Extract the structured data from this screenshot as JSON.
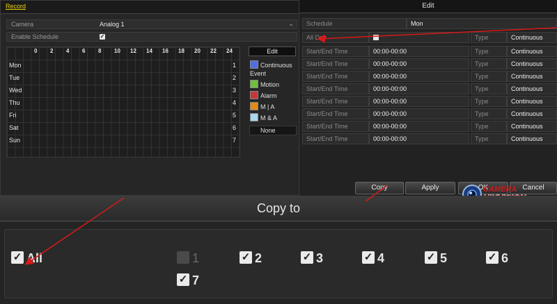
{
  "record": {
    "tab": "Record",
    "camera_label": "Camera",
    "camera_value": "Analog 1",
    "enable_label": "Enable Schedule",
    "enable_checked": true,
    "hours": [
      "0",
      "2",
      "4",
      "6",
      "8",
      "10",
      "12",
      "14",
      "16",
      "18",
      "20",
      "22",
      "24"
    ],
    "days": [
      {
        "name": "Mon",
        "num": "1"
      },
      {
        "name": "Tue",
        "num": "2"
      },
      {
        "name": "Wed",
        "num": "3"
      },
      {
        "name": "Thu",
        "num": "4"
      },
      {
        "name": "Fri",
        "num": "5"
      },
      {
        "name": "Sat",
        "num": "6"
      },
      {
        "name": "Sun",
        "num": "7"
      }
    ],
    "edit_button": "Edit",
    "legend": {
      "continuous": {
        "label": "Continuous",
        "color": "#4f6fe0"
      },
      "event_heading": "Event",
      "motion": {
        "label": "Motion",
        "color": "#6fbf3a"
      },
      "alarm": {
        "label": "Alarm",
        "color": "#c03a3a"
      },
      "m_or_a": {
        "label": "M | A",
        "color": "#e08a1a"
      },
      "m_and_a": {
        "label": "M & A",
        "color": "#a8d8f0"
      },
      "none": {
        "label": "None"
      }
    }
  },
  "edit": {
    "title": "Edit",
    "schedule_label": "Schedule",
    "schedule_value": "Mon",
    "allday_label": "All Day",
    "allday_checked": false,
    "rows_label": "Start/End Time",
    "time_value": "00:00-00:00",
    "type_label": "Type",
    "type_value": "Continuous",
    "allday_type_value": "Continuous",
    "buttons": {
      "copy": "Copy",
      "apply": "Apply",
      "ok": "OK",
      "cancel": "Cancel"
    },
    "watermark": {
      "line1": "CAMERA",
      "line2": "HIKVISION.vn"
    }
  },
  "copy_to": {
    "title": "Copy to",
    "all_label": "All",
    "all_checked": true,
    "days": [
      {
        "label": "1",
        "checked": false
      },
      {
        "label": "2",
        "checked": true
      },
      {
        "label": "3",
        "checked": true
      },
      {
        "label": "4",
        "checked": true
      },
      {
        "label": "5",
        "checked": true
      },
      {
        "label": "6",
        "checked": true
      },
      {
        "label": "7",
        "checked": true
      }
    ]
  }
}
